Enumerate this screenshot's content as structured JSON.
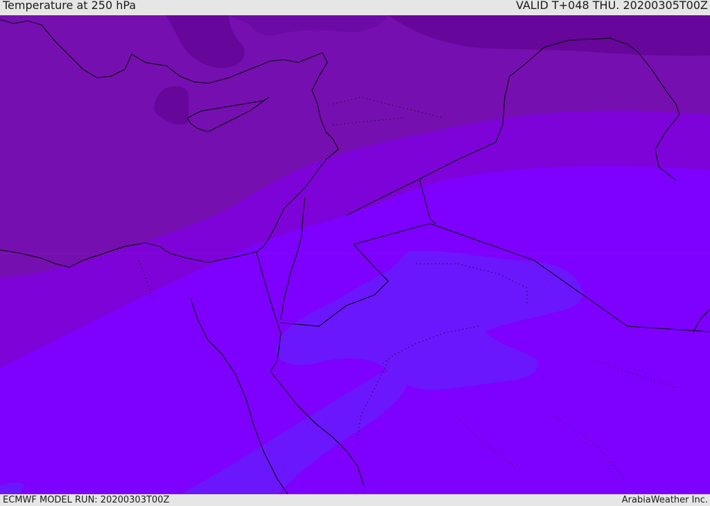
{
  "header": {
    "title": "Temperature at 250 hPa",
    "valid": "VALID T+048 THU. 20200305T00Z"
  },
  "footer": {
    "model_run": "ECMWF MODEL RUN: 20200303T00Z",
    "brand": "ArabiaWeather Inc."
  },
  "colors": {
    "band_coldest": "#66069a",
    "band_cold": "#760fb0",
    "band_mid": "#7e03d8",
    "band_warm": "#7e00fe",
    "band_warmest": "#6a17fd",
    "coastline": "#000000",
    "header_bg": "#e6e6e6"
  }
}
